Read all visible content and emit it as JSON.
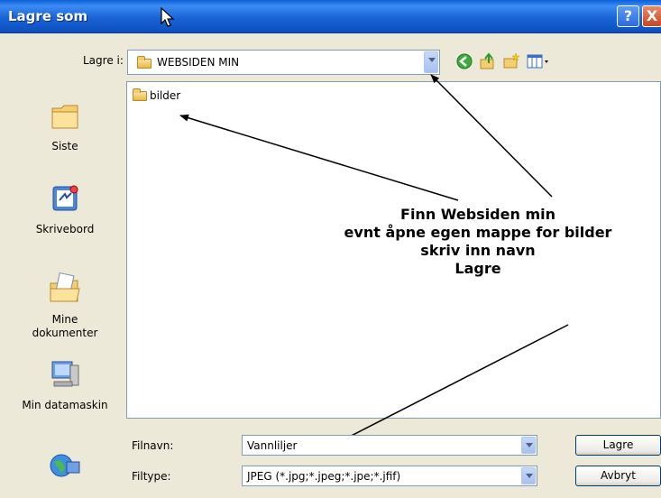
{
  "window": {
    "title": "Lagre som",
    "help_label": "?",
    "close_label": "X"
  },
  "lookin": {
    "label": "Lagre i:",
    "value": "WEBSIDEN MIN"
  },
  "toolbar": {
    "back_icon": "back-icon",
    "up_icon": "up-folder-icon",
    "new_folder_icon": "new-folder-icon",
    "views_icon": "views-menu-icon"
  },
  "places": [
    {
      "label": "Siste",
      "icon": "recent-folder-icon"
    },
    {
      "label": "Skrivebord",
      "icon": "desktop-icon"
    },
    {
      "label": "Mine dokumenter",
      "icon": "my-documents-icon"
    },
    {
      "label": "Min datamaskin",
      "icon": "my-computer-icon"
    },
    {
      "label": "",
      "icon": "network-places-icon"
    }
  ],
  "files": [
    {
      "name": "bilder",
      "type": "folder"
    }
  ],
  "annotation": {
    "line1": "Finn Websiden min",
    "line2": "evnt åpne egen mappe for bilder",
    "line3": "skriv inn navn",
    "line4": "Lagre"
  },
  "filename": {
    "label": "Filnavn:",
    "value": "Vannliljer"
  },
  "filetype": {
    "label": "Filtype:",
    "value": "JPEG (*.jpg;*.jpeg;*.jpe;*.jfif)"
  },
  "buttons": {
    "save": "Lagre",
    "cancel": "Avbryt"
  },
  "colors": {
    "titlebar": "#0A5FD8",
    "dialog_bg": "#ECE9D8",
    "border": "#7F9DB9"
  }
}
